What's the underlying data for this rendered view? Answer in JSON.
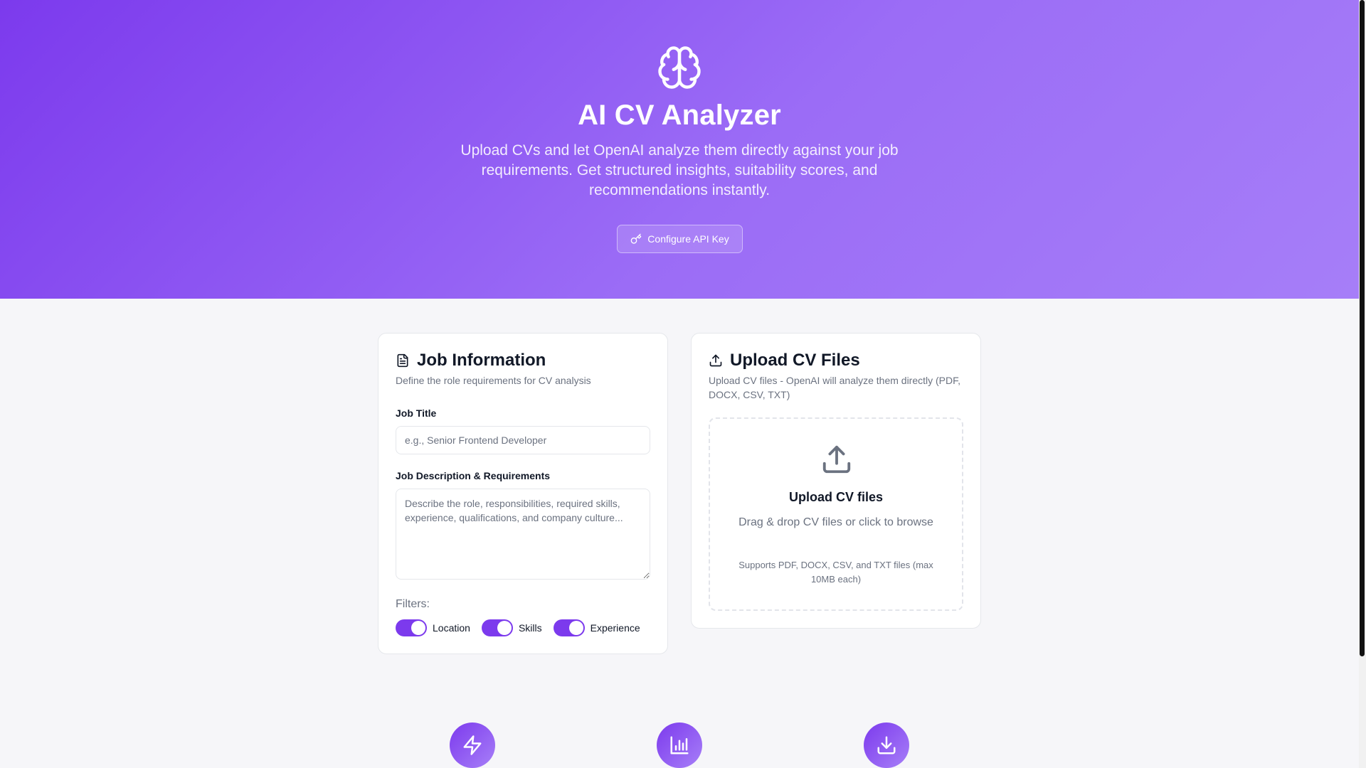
{
  "header": {
    "title": "AI CV Analyzer",
    "subtitle": "Upload CVs and let OpenAI analyze them directly against your job requirements. Get structured insights, suitability scores, and recommendations instantly.",
    "api_button_label": "Configure API Key",
    "logo_icon": "brain-icon"
  },
  "job_card": {
    "title": "Job Information",
    "description": "Define the role requirements for CV analysis",
    "job_title_label": "Job Title",
    "job_title_placeholder": "e.g., Senior Frontend Developer",
    "job_title_value": "",
    "job_desc_label": "Job Description & Requirements",
    "job_desc_placeholder": "Describe the role, responsibilities, required skills, experience, qualifications, and company culture...",
    "job_desc_value": "",
    "filters_label": "Filters:",
    "filters": [
      {
        "label": "Location",
        "enabled": true
      },
      {
        "label": "Skills",
        "enabled": true
      },
      {
        "label": "Experience",
        "enabled": true
      }
    ]
  },
  "upload_card": {
    "title": "Upload CV Files",
    "description": "Upload CV files - OpenAI will analyze them directly (PDF, DOCX, CSV, TXT)",
    "dropzone_title": "Upload CV files",
    "dropzone_text": "Drag & drop CV files or click to browse",
    "dropzone_note": "Supports PDF, DOCX, CSV, and TXT files (max 10MB each)"
  },
  "features": [
    {
      "icon": "lightning-icon"
    },
    {
      "icon": "bar-chart-icon"
    },
    {
      "icon": "download-icon"
    }
  ],
  "colors": {
    "accent": "#7c3aed",
    "hero_gradient_start": "#7c3aed",
    "hero_gradient_end": "#a67ef8",
    "background": "#f6f6f9"
  }
}
